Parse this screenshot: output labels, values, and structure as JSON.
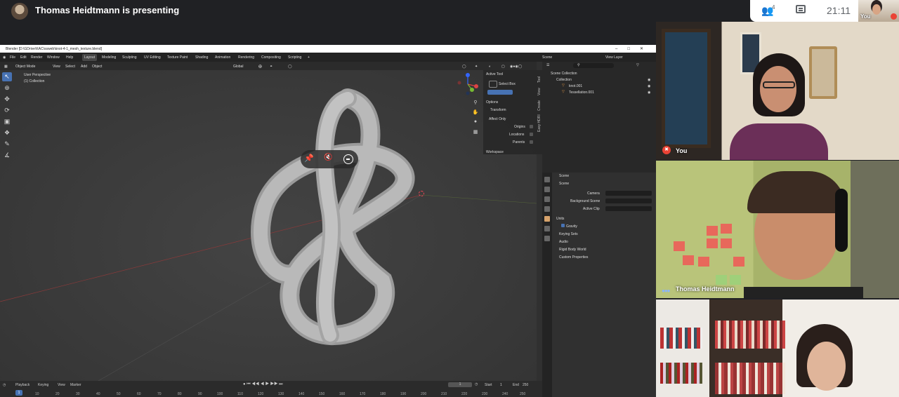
{
  "meet": {
    "presenting_text": "Thomas Heidtmann is presenting",
    "participant_count": "4",
    "clock": "21:11",
    "self_label": "You"
  },
  "blender": {
    "window_title": "Blender [D:\\GDrive\\KAC\\ssweb\\knot-4-1_mesh_texture.blend]",
    "menus": [
      "File",
      "Edit",
      "Render",
      "Window",
      "Help"
    ],
    "workspaces": [
      "Layout",
      "Modeling",
      "Sculpting",
      "UV Editing",
      "Texture Paint",
      "Shading",
      "Animation",
      "Rendering",
      "Compositing",
      "Scripting"
    ],
    "active_workspace": "Layout",
    "scene_field": "Scene",
    "view_layer_field": "View Layer",
    "header": {
      "mode": "Object Mode",
      "menus": [
        "View",
        "Select",
        "Add",
        "Object"
      ],
      "transform_orientation": "Global"
    },
    "viewport": {
      "perspective": "User Perspective",
      "collection": "(1) Collection"
    },
    "npanel": {
      "active_tool_header": "Active Tool",
      "active_tool": "Select Box",
      "options_header": "Options",
      "transform_header": "Transform",
      "affect_only": "Affect Only",
      "origins": "Origins",
      "locations": "Locations",
      "parents": "Parents",
      "workspace_header": "Workspace",
      "tabs": [
        "Tool",
        "View",
        "Create",
        "Easy HDRI"
      ]
    },
    "timeline": {
      "playback": "Playback",
      "keying": "Keying",
      "view": "View",
      "marker": "Marker",
      "current_frame": "1",
      "start_label": "Start",
      "start_value": "1",
      "end_label": "End",
      "end_value": "250",
      "ruler": [
        "1",
        "10",
        "20",
        "30",
        "40",
        "50",
        "60",
        "70",
        "80",
        "90",
        "100",
        "110",
        "120",
        "130",
        "140",
        "150",
        "160",
        "170",
        "180",
        "190",
        "200",
        "210",
        "220",
        "230",
        "240",
        "250"
      ]
    },
    "outliner": {
      "scene_collection": "Scene Collection",
      "collection": "Collection",
      "items": [
        "knot.001",
        "Tessellation.001"
      ]
    },
    "properties": {
      "header": "Scene",
      "section": "Scene",
      "camera_label": "Camera",
      "background_scene_label": "Background Scene",
      "active_clip_label": "Active Clip",
      "panels": [
        "Units",
        "Gravity",
        "Keying Sets",
        "Audio",
        "Rigid Body World",
        "Custom Properties"
      ]
    }
  },
  "tiles": [
    {
      "name": "You"
    },
    {
      "name": "Thomas Heidtmann"
    },
    {
      "name": ""
    }
  ],
  "colors": {
    "meet_bg": "#202124",
    "blender_accent": "#4772b3",
    "mic_off": "#ea4335",
    "speaking": "#8ab4f8"
  }
}
